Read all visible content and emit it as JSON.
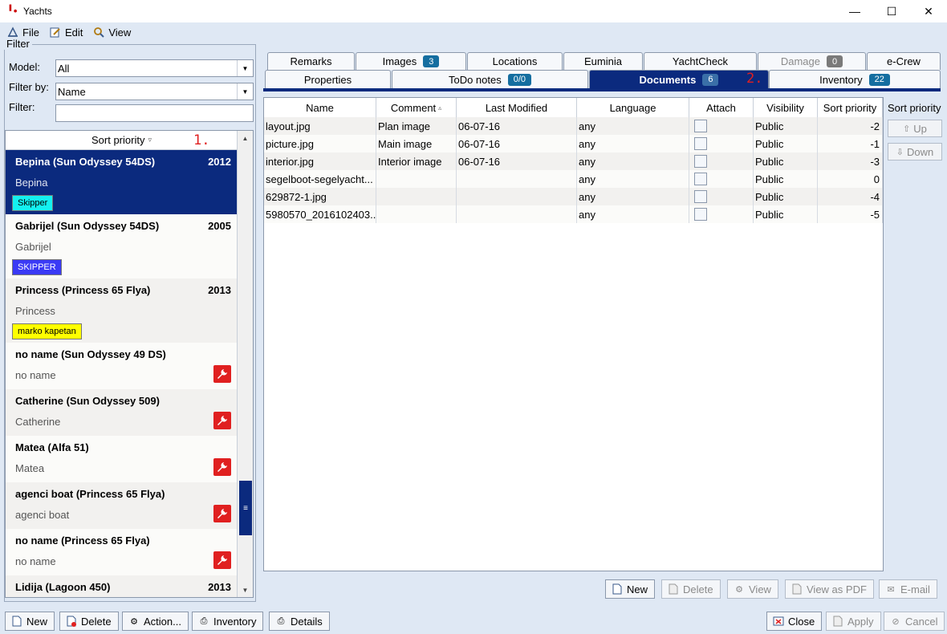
{
  "window": {
    "title": "Yachts",
    "minimize": "—",
    "maximize": "☐",
    "close": "✕",
    "app_icon": "yacht-logo-icon"
  },
  "menu": [
    {
      "label": "File",
      "icon": "file-icon"
    },
    {
      "label": "Edit",
      "icon": "edit-icon"
    },
    {
      "label": "View",
      "icon": "view-icon"
    }
  ],
  "filter": {
    "legend": "Filter",
    "model_label": "Model:",
    "model_value": "All",
    "filter_by_label": "Filter by:",
    "filter_by_value": "Name",
    "filter_label": "Filter:",
    "filter_value": ""
  },
  "yacht_list": {
    "header": "Sort priority",
    "sort_arrow": "▿",
    "annotation": "1.",
    "items": [
      {
        "name": "Bepina (Sun Odyssey 54DS)",
        "year": "2012",
        "sub": "Bepina",
        "badge": "Skipper",
        "badge_bg": "#14f0f0",
        "badge_color": "#000000",
        "selected": true
      },
      {
        "name": "Gabrijel (Sun Odyssey 54DS)",
        "year": "2005",
        "sub": "Gabrijel",
        "badge": "SKIPPER",
        "badge_bg": "#3a3af5",
        "badge_color": "#ffffff"
      },
      {
        "name": "Princess (Princess 65 Flya)",
        "year": "2013",
        "sub": "Princess",
        "badge": "marko kapetan",
        "badge_bg": "#ffff00",
        "badge_color": "#000000"
      },
      {
        "name": "no name (Sun Odyssey 49 DS)",
        "year": "",
        "sub": "no name",
        "wrench": true
      },
      {
        "name": "Catherine (Sun Odyssey 509)",
        "year": "",
        "sub": "Catherine",
        "wrench": true
      },
      {
        "name": "Matea (Alfa 51)",
        "year": "",
        "sub": "Matea",
        "wrench": true
      },
      {
        "name": "agenci boat (Princess 65 Flya)",
        "year": "",
        "sub": "agenci boat",
        "wrench": true
      },
      {
        "name": "no name (Princess 65 Flya)",
        "year": "",
        "sub": "no name",
        "wrench": true
      },
      {
        "name": "Lidija (Lagoon 450)",
        "year": "2013",
        "sub": ""
      }
    ]
  },
  "tabs_row1": [
    {
      "label": "Remarks"
    },
    {
      "label": "Images",
      "count": "3"
    },
    {
      "label": "Locations"
    },
    {
      "label": "Euminia"
    },
    {
      "label": "YachtCheck"
    },
    {
      "label": "Damage",
      "count": "0",
      "disabled": true
    },
    {
      "label": "e-Crew"
    }
  ],
  "tabs_row2": [
    {
      "label": "Properties"
    },
    {
      "label": "ToDo notes",
      "count": "0/0"
    },
    {
      "label": "Documents",
      "count": "6",
      "active": true
    },
    {
      "label": "Inventory",
      "count": "22"
    }
  ],
  "tab_annotation": "2.",
  "documents": {
    "columns": [
      "Name",
      "Comment",
      "Last Modified",
      "Language",
      "Attach",
      "Visibility",
      "Sort priority"
    ],
    "comment_sort_arrow": "▵",
    "rows": [
      {
        "name": "layout.jpg",
        "comment": "Plan image",
        "modified": "06-07-16",
        "language": "any",
        "visibility": "Public",
        "sort": "-2"
      },
      {
        "name": "picture.jpg",
        "comment": "Main image",
        "modified": "06-07-16",
        "language": "any",
        "visibility": "Public",
        "sort": "-1"
      },
      {
        "name": "interior.jpg",
        "comment": "Interior image",
        "modified": "06-07-16",
        "language": "any",
        "visibility": "Public",
        "sort": "-3"
      },
      {
        "name": "segelboot-segelyacht...",
        "comment": "",
        "modified": "",
        "language": "any",
        "visibility": "Public",
        "sort": "0"
      },
      {
        "name": "629872-1.jpg",
        "comment": "",
        "modified": "",
        "language": "any",
        "visibility": "Public",
        "sort": "-4"
      },
      {
        "name": "5980570_2016102403...",
        "comment": "",
        "modified": "",
        "language": "any",
        "visibility": "Public",
        "sort": "-5"
      }
    ]
  },
  "sort_priority": {
    "label": "Sort priority",
    "up": "Up",
    "down": "Down"
  },
  "doc_buttons": {
    "new": "New",
    "delete": "Delete",
    "view": "View",
    "view_pdf": "View as PDF",
    "email": "E-mail"
  },
  "bottom_buttons": {
    "new": "New",
    "delete": "Delete",
    "action": "Action...",
    "inventory": "Inventory",
    "details": "Details",
    "close": "Close",
    "apply": "Apply",
    "cancel": "Cancel"
  },
  "colors": {
    "selection": "#0b2a7e",
    "wrench": "#e02020",
    "count_badge": "#156ea0",
    "background": "#dfe8f4"
  }
}
